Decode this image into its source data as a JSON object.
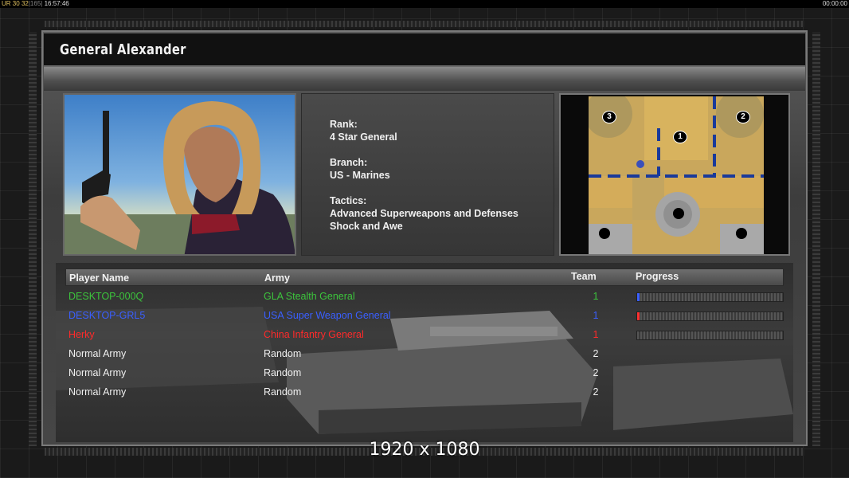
{
  "hud": {
    "stats_prefix": "UR",
    "stat_a": "30",
    "stat_b": "32",
    "stat_c": "165",
    "clock": "16:57:46",
    "timer": "00:00:00"
  },
  "general": {
    "name": "General Alexander",
    "rank_label": "Rank:",
    "rank_value": "4 Star General",
    "branch_label": "Branch:",
    "branch_value": "US - Marines",
    "tactics_label": "Tactics:",
    "tactics_line1": "Advanced Superweapons and Defenses",
    "tactics_line2": "Shock and Awe"
  },
  "map": {
    "start_positions": [
      "1",
      "2",
      "3"
    ]
  },
  "table": {
    "headers": {
      "player": "Player Name",
      "army": "Army",
      "team": "Team",
      "progress": "Progress"
    },
    "rows": [
      {
        "player": "DESKTOP-000Q",
        "army": "GLA Stealth General",
        "team": "1",
        "color": "#3cc43c",
        "progress": 0.01,
        "fill": "#3a5fff"
      },
      {
        "player": "DESKTOP-GRL5",
        "army": "USA Super Weapon General",
        "team": "1",
        "color": "#3a5fff",
        "progress": 0.01,
        "fill": "#ff3030"
      },
      {
        "player": "Herky",
        "army": "China Infantry General",
        "team": "1",
        "color": "#ff2a2a",
        "progress": 0.0,
        "fill": "#ff3030"
      },
      {
        "player": "Normal Army",
        "army": "Random",
        "team": "2",
        "color": "#f0f0f0"
      },
      {
        "player": "Normal Army",
        "army": "Random",
        "team": "2",
        "color": "#f0f0f0"
      },
      {
        "player": "Normal Army",
        "army": "Random",
        "team": "2",
        "color": "#f0f0f0"
      }
    ]
  },
  "resolution_label": "1920 x 1080"
}
